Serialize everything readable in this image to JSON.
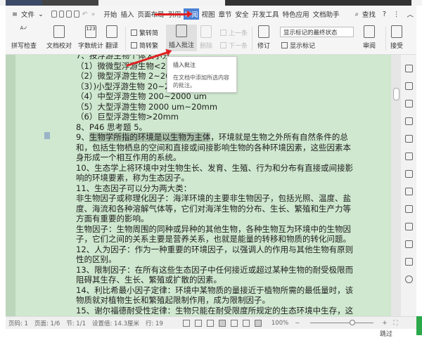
{
  "menu": {
    "file": "文件",
    "tabs": [
      "开始",
      "插入",
      "页面布局",
      "引用",
      "审阅",
      "视图",
      "章节",
      "安全",
      "开发工具",
      "特色应用",
      "文档助手"
    ],
    "active": "审阅",
    "search": "查找"
  },
  "toolbar": {
    "spell": "拼写检查",
    "proof": "文档校对",
    "wordcount": "字数统计",
    "translate": "翻译",
    "trad": "繁转简",
    "simp": "简转繁",
    "insert_comment": "插入批注",
    "delete": "删除",
    "prev": "上一条",
    "next": "下一条",
    "track": "修订",
    "display_mode": "显示标记的最终状态",
    "show_marks": "显示标记",
    "review": "审阅",
    "accept": "接受"
  },
  "tooltip": {
    "title": "插入批注",
    "desc": "在文档中添加所选内容的批注。"
  },
  "doc": {
    "lines": [
      "7、按浮游生物个体大小分：",
      "（1）微微型浮游生物<2 um",
      "（2）微型浮游生物 2~20 um",
      "（3）)小型浮游生物 20~200 um",
      "（4）中型浮游生物 200~2000 um",
      "（5）大型浮游生物 2000 um~20mm",
      "（6）巨型浮游生物>20mm",
      "8、P46 思考题 5。"
    ],
    "p9_highlight": "生物学所指的环境是以生物为主体",
    "p9_prefix": "9、",
    "p9_rest": "，环境就是生物之外所有自然条件的总和，包括生物栖息的空间和直接或间接影响生物的各种环境因素，这些因素本身形成一个相互作用的系统。",
    "paras": [
      "10、生态学上将环境中对生物生长、发育、生殖、行为和分布有直接或间接影响的环境要素，称为生态因子。",
      "11、生态因子可以分为两大类：",
      "非生物因子或称理化因子：海洋环境的主要非生物因子，包括光照、温度、盐度、海流和各种溶解气体等，它们对海洋生物的分布、生长、繁殖和生产力等方面有重要的影响。",
      "生物因子：生物周围的同种或异种的其他生物，各种生物互为环境中的生物因子，它们之间的关系主要是营养关系，也就是能量的转移和物质的转化问题。",
      "12、人为因子：作为一种重要的环境因子，以强调人的作用与其他生物有原则性的区别。",
      "13、限制因子：在所有这些生态因子中任何接近或超过某种生物的耐受极限而阻碍其生存、生长、繁殖或扩散的因素。",
      "14、利比希最小因子定律：环境中某物质的量接近于植物所需的最低量时，该物质就对植物生长和繁殖起限制作用，成为限制因子。",
      "15、谢尔福德耐受性定律：生物只能在耐受限度所规定的生态环境中生存，这种"
    ]
  },
  "status": {
    "page": "页码: 1",
    "pages": "页面: 1/6",
    "section": "节: 1/1",
    "setting": "设置值: 14.3厘米",
    "row": "行: 19",
    "zoom": "100%",
    "skip": "跳过"
  },
  "colors": {
    "doc_bg": "#cfe8cf",
    "active_tab": "#4a7fd4",
    "arrow": "#e02020"
  }
}
